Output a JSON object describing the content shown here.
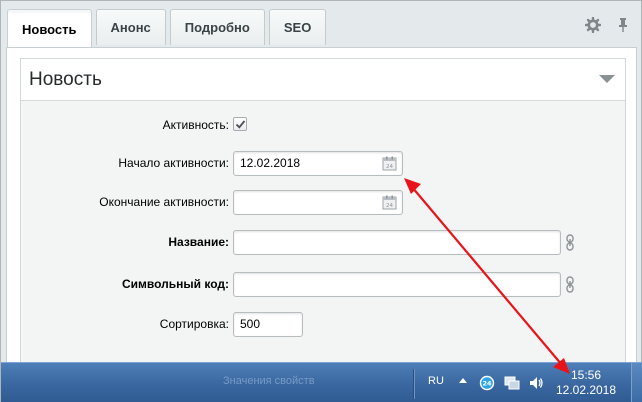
{
  "tabs": [
    {
      "label": "Новость",
      "active": true
    },
    {
      "label": "Анонс",
      "active": false
    },
    {
      "label": "Подробно",
      "active": false
    },
    {
      "label": "SEO",
      "active": false
    }
  ],
  "tab_tools": {
    "settings_icon": "gear-icon",
    "pin_icon": "pin-icon"
  },
  "section": {
    "title": "Новость",
    "collapse_icon": "triangle-down-icon"
  },
  "form": {
    "active": {
      "label": "Активность:",
      "checked": true
    },
    "start": {
      "label": "Начало активности:",
      "value": "12.02.2018"
    },
    "end": {
      "label": "Окончание активности:",
      "value": ""
    },
    "name": {
      "label": "Название:",
      "value": ""
    },
    "code": {
      "label": "Символьный код:",
      "value": ""
    },
    "sort": {
      "label": "Сортировка:",
      "value": "500"
    }
  },
  "taskbar": {
    "ghost_text": "Значения свойств",
    "lang": "RU",
    "tray_icons": [
      "bitrix24-icon",
      "network-icon",
      "volume-icon"
    ],
    "time": "15:56",
    "date": "12.02.2018"
  },
  "annotation": {
    "color": "#e8141a",
    "description": "double-headed arrow from date field to taskbar clock"
  }
}
